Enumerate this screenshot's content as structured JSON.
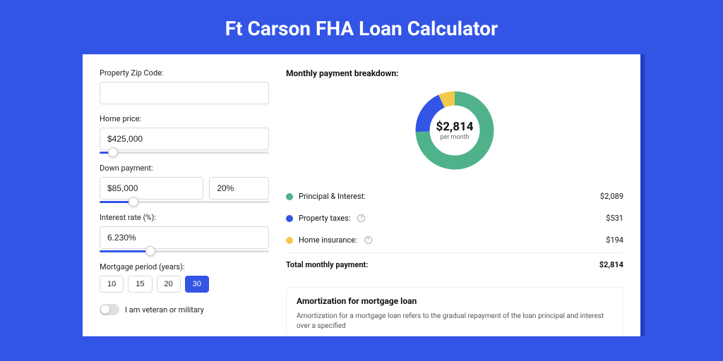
{
  "title": "Ft Carson FHA Loan Calculator",
  "form": {
    "zip_label": "Property Zip Code:",
    "zip_value": "",
    "home_price_label": "Home price:",
    "home_price_value": "$425,000",
    "home_price_slider_pct": 8,
    "down_label": "Down payment:",
    "down_value": "$85,000",
    "down_pct": "20%",
    "down_slider_pct": 20,
    "rate_label": "Interest rate (%):",
    "rate_value": "6.230%",
    "rate_slider_pct": 30,
    "period_label": "Mortgage period (years):",
    "periods": [
      "10",
      "15",
      "20",
      "30"
    ],
    "period_selected": "30",
    "veteran_label": "I am veteran or military"
  },
  "breakdown": {
    "title": "Monthly payment breakdown:",
    "center_amount": "$2,814",
    "center_sub": "per month",
    "items": [
      {
        "label": "Principal & Interest:",
        "value": "$2,089",
        "color": "green",
        "info": false
      },
      {
        "label": "Property taxes:",
        "value": "$531",
        "color": "blue",
        "info": true
      },
      {
        "label": "Home insurance:",
        "value": "$194",
        "color": "yellow",
        "info": true
      }
    ],
    "total_label": "Total monthly payment:",
    "total_value": "$2,814"
  },
  "amort": {
    "title": "Amortization for mortgage loan",
    "text": "Amortization for a mortgage loan refers to the gradual repayment of the loan principal and interest over a specified"
  },
  "chart_data": {
    "type": "pie",
    "title": "Monthly payment breakdown",
    "series": [
      {
        "name": "Principal & Interest",
        "value": 2089,
        "color": "#4fb28a"
      },
      {
        "name": "Property taxes",
        "value": 531,
        "color": "#3355e6"
      },
      {
        "name": "Home insurance",
        "value": 194,
        "color": "#f2c94c"
      }
    ],
    "total": 2814
  }
}
